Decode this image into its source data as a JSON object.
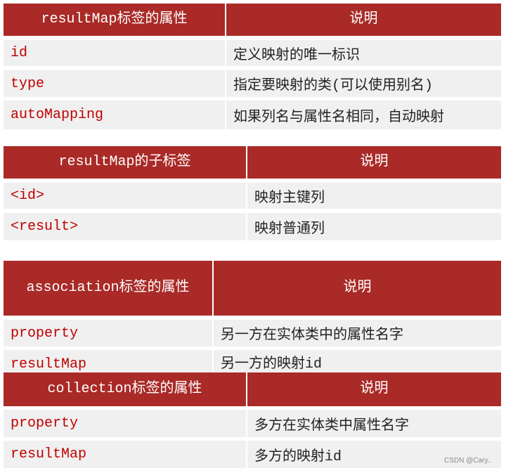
{
  "colors": {
    "header_bg": "#a92a27",
    "row_bg": "#f0f0f0",
    "key_text": "#c00000"
  },
  "tables": [
    {
      "header": [
        "resultMap标签的属性",
        "说明"
      ],
      "rows": [
        [
          "id",
          "定义映射的唯一标识"
        ],
        [
          "type",
          "指定要映射的类(可以使用别名)"
        ],
        [
          "autoMapping",
          "如果列名与属性名相同，自动映射"
        ]
      ]
    },
    {
      "header": [
        "resultMap的子标签",
        "说明"
      ],
      "rows": [
        [
          "<id>",
          "映射主键列"
        ],
        [
          "<result>",
          "映射普通列"
        ]
      ]
    },
    {
      "header": [
        "association标签的属性",
        "说明"
      ],
      "rows": [
        [
          "property",
          "另一方在实体类中的属性名字"
        ],
        [
          "resultMap",
          "另一方的映射id"
        ]
      ]
    },
    {
      "header": [
        "collection标签的属性",
        "说明"
      ],
      "rows": [
        [
          "property",
          "多方在实体类中属性名字"
        ],
        [
          "resultMap",
          "多方的映射id"
        ]
      ]
    }
  ],
  "watermark": "CSDN @Cary.."
}
